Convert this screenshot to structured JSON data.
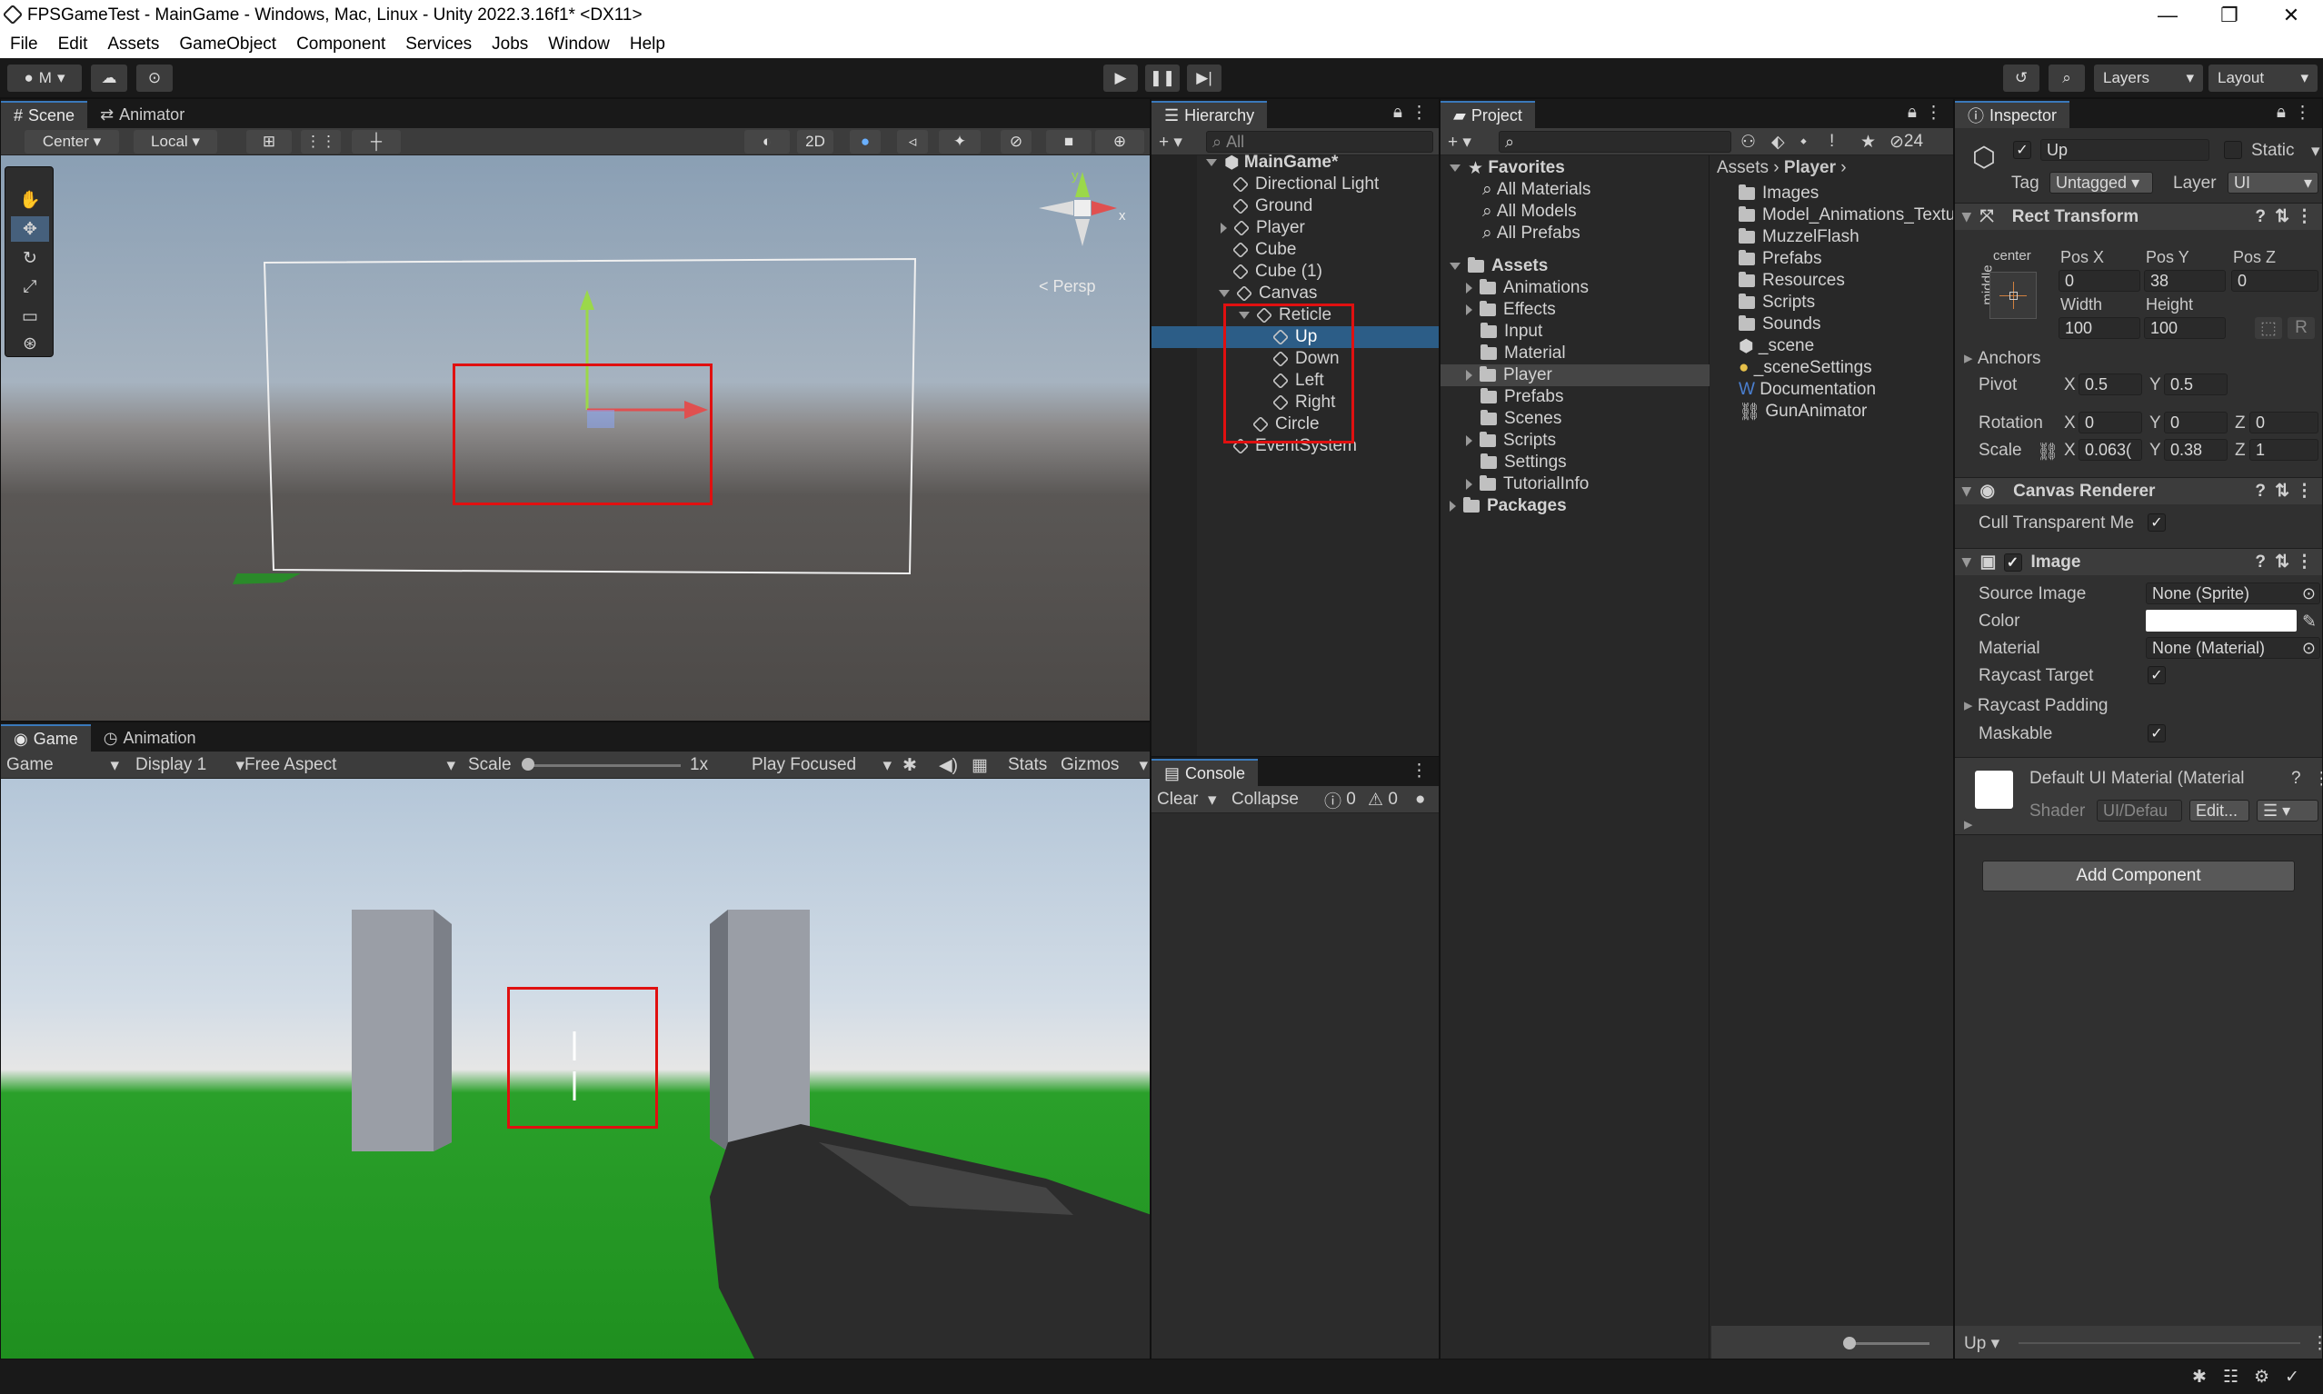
{
  "window": {
    "title": "FPSGameTest - MainGame - Windows, Mac, Linux - Unity 2022.3.16f1* <DX11>",
    "min": "—",
    "max": "❐",
    "close": "✕"
  },
  "menu": [
    "File",
    "Edit",
    "Assets",
    "GameObject",
    "Component",
    "Services",
    "Jobs",
    "Window",
    "Help"
  ],
  "toolbar": {
    "account": "M",
    "layers": "Layers",
    "layout": "Layout"
  },
  "scene": {
    "tabs": [
      "Scene",
      "Animator"
    ],
    "pivot": "Center",
    "space": "Local",
    "mode2d": "2D",
    "persp": "Persp",
    "axes": {
      "x": "x",
      "y": "y"
    }
  },
  "game": {
    "tabs": [
      "Game",
      "Animation"
    ],
    "view": "Game",
    "display": "Display 1",
    "aspect": "Free Aspect",
    "scale_label": "Scale",
    "scale_value": "1x",
    "play_mode": "Play Focused",
    "stats": "Stats",
    "gizmos": "Gizmos"
  },
  "hierarchy": {
    "tab": "Hierarchy",
    "search": "All",
    "items": [
      "MainGame*",
      "Directional Light",
      "Ground",
      "Player",
      "Cube",
      "Cube (1)",
      "Canvas",
      "Reticle",
      "Up",
      "Down",
      "Left",
      "Right",
      "Circle",
      "EventSystem"
    ]
  },
  "console": {
    "tab": "Console",
    "clear": "Clear",
    "collapse": "Collapse",
    "warn": "0",
    "err": "0"
  },
  "project": {
    "tab": "Project",
    "hidden_count": "24",
    "favorites": "Favorites",
    "fav_items": [
      "All Materials",
      "All Models",
      "All Prefabs"
    ],
    "assets": "Assets",
    "asset_folders": [
      "Animations",
      "Effects",
      "Input",
      "Material",
      "Player",
      "Prefabs",
      "Scenes",
      "Scripts",
      "Settings",
      "TutorialInfo"
    ],
    "packages": "Packages",
    "breadcrumb": [
      "Assets",
      "Player"
    ],
    "files": [
      "Images",
      "Model_Animations_Textu",
      "MuzzelFlash",
      "Prefabs",
      "Resources",
      "Scripts",
      "Sounds",
      "_scene",
      "_sceneSettings",
      "Documentation",
      "GunAnimator"
    ]
  },
  "inspector": {
    "tab": "Inspector",
    "name": "Up",
    "static": "Static",
    "tag_label": "Tag",
    "tag": "Untagged",
    "layer_label": "Layer",
    "layer": "UI",
    "rect": {
      "title": "Rect Transform",
      "anchor_h": "center",
      "anchor_v": "middle",
      "posx_l": "Pos X",
      "posy_l": "Pos Y",
      "posz_l": "Pos Z",
      "posx": "0",
      "posy": "38",
      "posz": "0",
      "width_l": "Width",
      "height_l": "Height",
      "width": "100",
      "height": "100",
      "r": "R",
      "anchors": "Anchors",
      "pivot": "Pivot",
      "pivx": "0.5",
      "pivy": "0.5",
      "rotation": "Rotation",
      "rotx": "0",
      "roty": "0",
      "rotz": "0",
      "scale": "Scale",
      "scx": "0.063(",
      "scy": "0.38",
      "scz": "1",
      "x": "X",
      "y": "Y",
      "z": "Z"
    },
    "canvas_renderer": {
      "title": "Canvas Renderer",
      "cull": "Cull Transparent Me"
    },
    "image": {
      "title": "Image",
      "source_l": "Source Image",
      "source": "None (Sprite)",
      "color_l": "Color",
      "material_l": "Material",
      "material": "None (Material)",
      "raycast": "Raycast Target",
      "padding": "Raycast Padding",
      "maskable": "Maskable"
    },
    "material": {
      "name": "Default UI Material (Material",
      "shader_l": "Shader",
      "shader": "UI/Defau",
      "edit": "Edit..."
    },
    "add_component": "Add Component",
    "footer": "Up"
  }
}
